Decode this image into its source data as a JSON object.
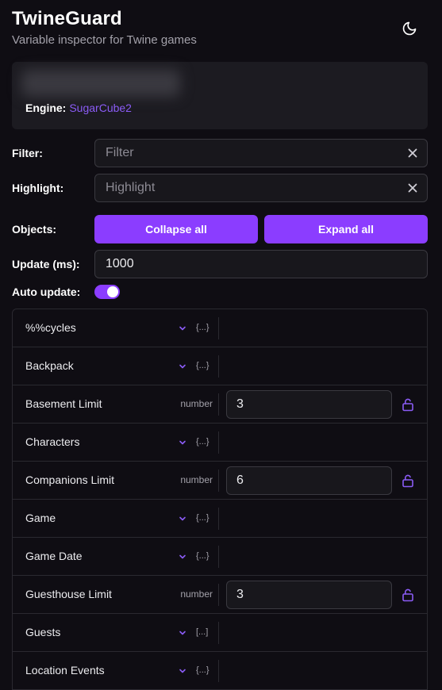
{
  "app": {
    "title": "TwineGuard",
    "subtitle": "Variable inspector for Twine games",
    "theme_icon": "moon-icon"
  },
  "info": {
    "engine_label": "Engine:",
    "engine_value": "SugarCube2"
  },
  "filter": {
    "label": "Filter:",
    "placeholder": "Filter",
    "value": ""
  },
  "highlight": {
    "label": "Highlight:",
    "placeholder": "Highlight",
    "value": ""
  },
  "objects": {
    "label": "Objects:",
    "collapse_label": "Collapse all",
    "expand_label": "Expand all"
  },
  "update": {
    "label": "Update (ms):",
    "value": "1000"
  },
  "auto_update": {
    "label": "Auto update:",
    "enabled": true
  },
  "variables": [
    {
      "name": "%%cycles",
      "kind": "object",
      "brace": "{...}"
    },
    {
      "name": "Backpack",
      "kind": "object",
      "brace": "{...}"
    },
    {
      "name": "Basement Limit",
      "kind": "value",
      "type": "number",
      "value": "3"
    },
    {
      "name": "Characters",
      "kind": "object",
      "brace": "{...}"
    },
    {
      "name": "Companions Limit",
      "kind": "value",
      "type": "number",
      "value": "6"
    },
    {
      "name": "Game",
      "kind": "object",
      "brace": "{...}"
    },
    {
      "name": "Game Date",
      "kind": "object",
      "brace": "{...}"
    },
    {
      "name": "Guesthouse Limit",
      "kind": "value",
      "type": "number",
      "value": "3"
    },
    {
      "name": "Guests",
      "kind": "object",
      "brace": "[...]"
    },
    {
      "name": "Location Events",
      "kind": "object",
      "brace": "{...}"
    }
  ],
  "colors": {
    "accent": "#8b3dff",
    "engine_link": "#8b5cf6",
    "background": "#0f0d13"
  }
}
